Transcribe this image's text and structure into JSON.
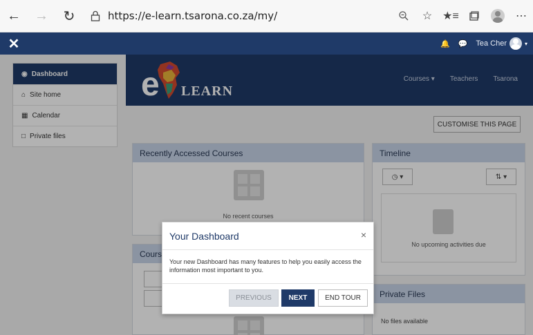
{
  "browser": {
    "url": "https://e-learn.tsarona.co.za/my/"
  },
  "navbar": {
    "username": "Tea Cher"
  },
  "drawer": {
    "items": [
      {
        "label": "Dashboard",
        "icon": "dashboard-icon",
        "active": true
      },
      {
        "label": "Site home",
        "icon": "home-icon"
      },
      {
        "label": "Calendar",
        "icon": "calendar-icon"
      },
      {
        "label": "Private files",
        "icon": "file-icon"
      }
    ]
  },
  "banner": {
    "logo_e": "e",
    "logo_learn": "LEARN",
    "nav": [
      "Courses ▾",
      "Teachers",
      "Tsarona"
    ]
  },
  "customise_label": "CUSTOMISE THIS PAGE",
  "recent_courses": {
    "title": "Recently Accessed Courses",
    "empty": "No recent courses"
  },
  "course_overview": {
    "title": "Course"
  },
  "timeline": {
    "title": "Timeline",
    "empty": "No upcoming activities due"
  },
  "private_files": {
    "title": "Private Files",
    "empty": "No files available"
  },
  "modal": {
    "title": "Your Dashboard",
    "close": "×",
    "body": "Your new Dashboard has many features to help you easily access the information most important to you.",
    "prev": "PREVIOUS",
    "next": "NEXT",
    "end": "END TOUR"
  },
  "colors": {
    "brand": "#1f3a68",
    "card_header": "#c7d4e8"
  }
}
